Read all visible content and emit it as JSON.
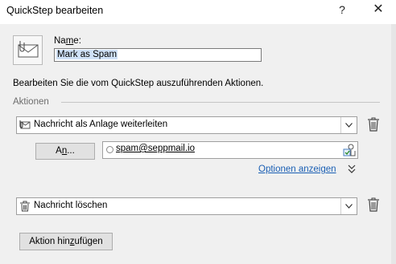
{
  "window": {
    "title": "QuickStep bearbeiten",
    "help_label": "?",
    "close_label": "✕"
  },
  "name_field": {
    "label_pre": "Na",
    "label_key": "m",
    "label_post": "e:",
    "value": "Mark as Spam"
  },
  "description": "Bearbeiten Sie die vom QuickStep auszuführenden Aktionen.",
  "actions_section": {
    "label": "Aktionen"
  },
  "actions": [
    {
      "label": "Nachricht als Anlage weiterleiten",
      "icon": "forward-attachment-icon",
      "to_button": {
        "pre": "A",
        "key": "n",
        "post": "..."
      },
      "recipient": "spam@seppmail.io",
      "options_link": "Optionen anzeigen"
    },
    {
      "label": "Nachricht löschen",
      "icon": "trash-icon"
    }
  ],
  "add_button": {
    "pre": "Aktion hin",
    "key": "z",
    "post": "ufügen"
  },
  "colors": {
    "link": "#1a5fb4",
    "selection": "#cfe1f7",
    "panel": "#f0f0f0"
  }
}
